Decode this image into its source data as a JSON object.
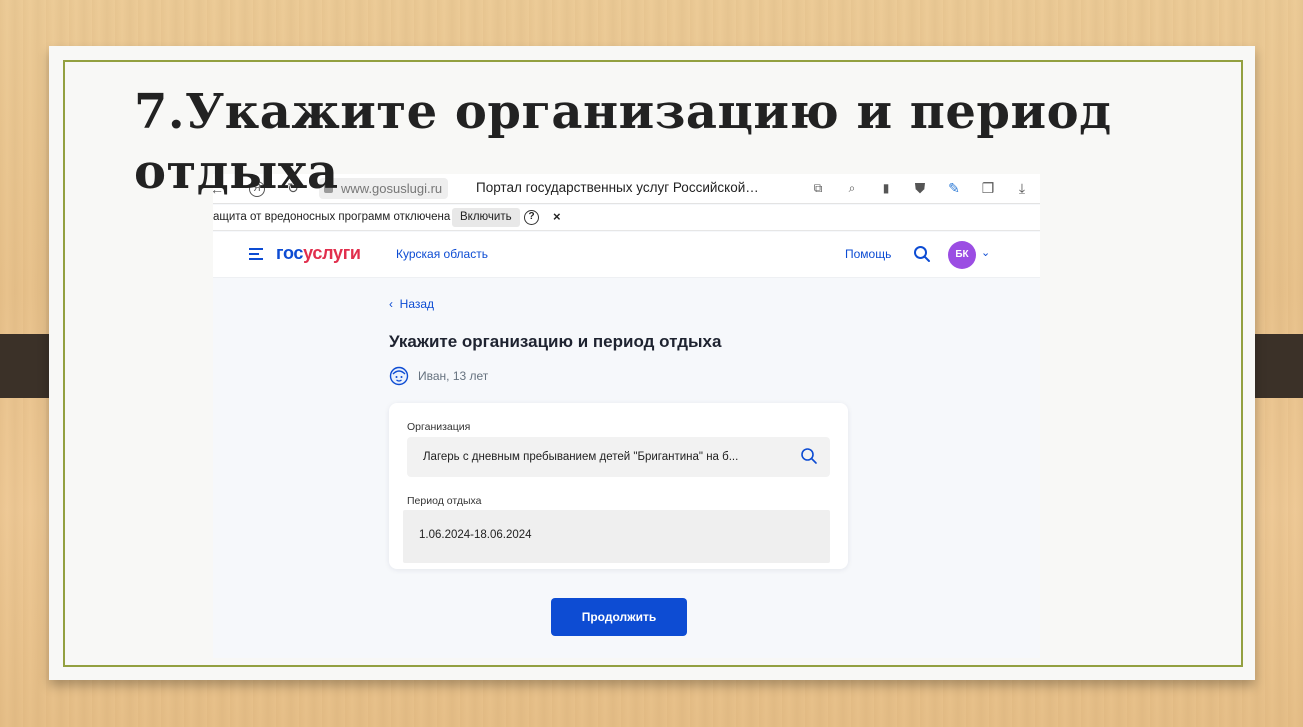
{
  "slide": {
    "title": "7.Укажите организацию и период отдыха"
  },
  "browser": {
    "url": "www.gosuslugi.ru",
    "tab_title": "Портал государственных услуг Российской…",
    "warning_text": "ащита от вредоносных программ отключена",
    "enable_label": "Включить",
    "help_label": "?",
    "close_label": "×"
  },
  "header": {
    "logo_part1": "гос",
    "logo_part2": "услуги",
    "region": "Курская область",
    "help": "Помощь",
    "avatar_initials": "БК"
  },
  "page": {
    "back": "Назад",
    "heading": "Укажите организацию и период отдыха",
    "child": "Иван, 13 лет",
    "org_label": "Организация",
    "org_value": "Лагерь с дневным пребыванием детей \"Бригантина\" на б...",
    "period_label": "Период отдыха",
    "period_value": "1.06.2024-18.06.2024",
    "continue": "Продолжить"
  },
  "colors": {
    "brand_blue": "#0d4cd3",
    "brand_red": "#e12f4d",
    "avatar": "#9b4de3",
    "frame": "#93a040"
  }
}
